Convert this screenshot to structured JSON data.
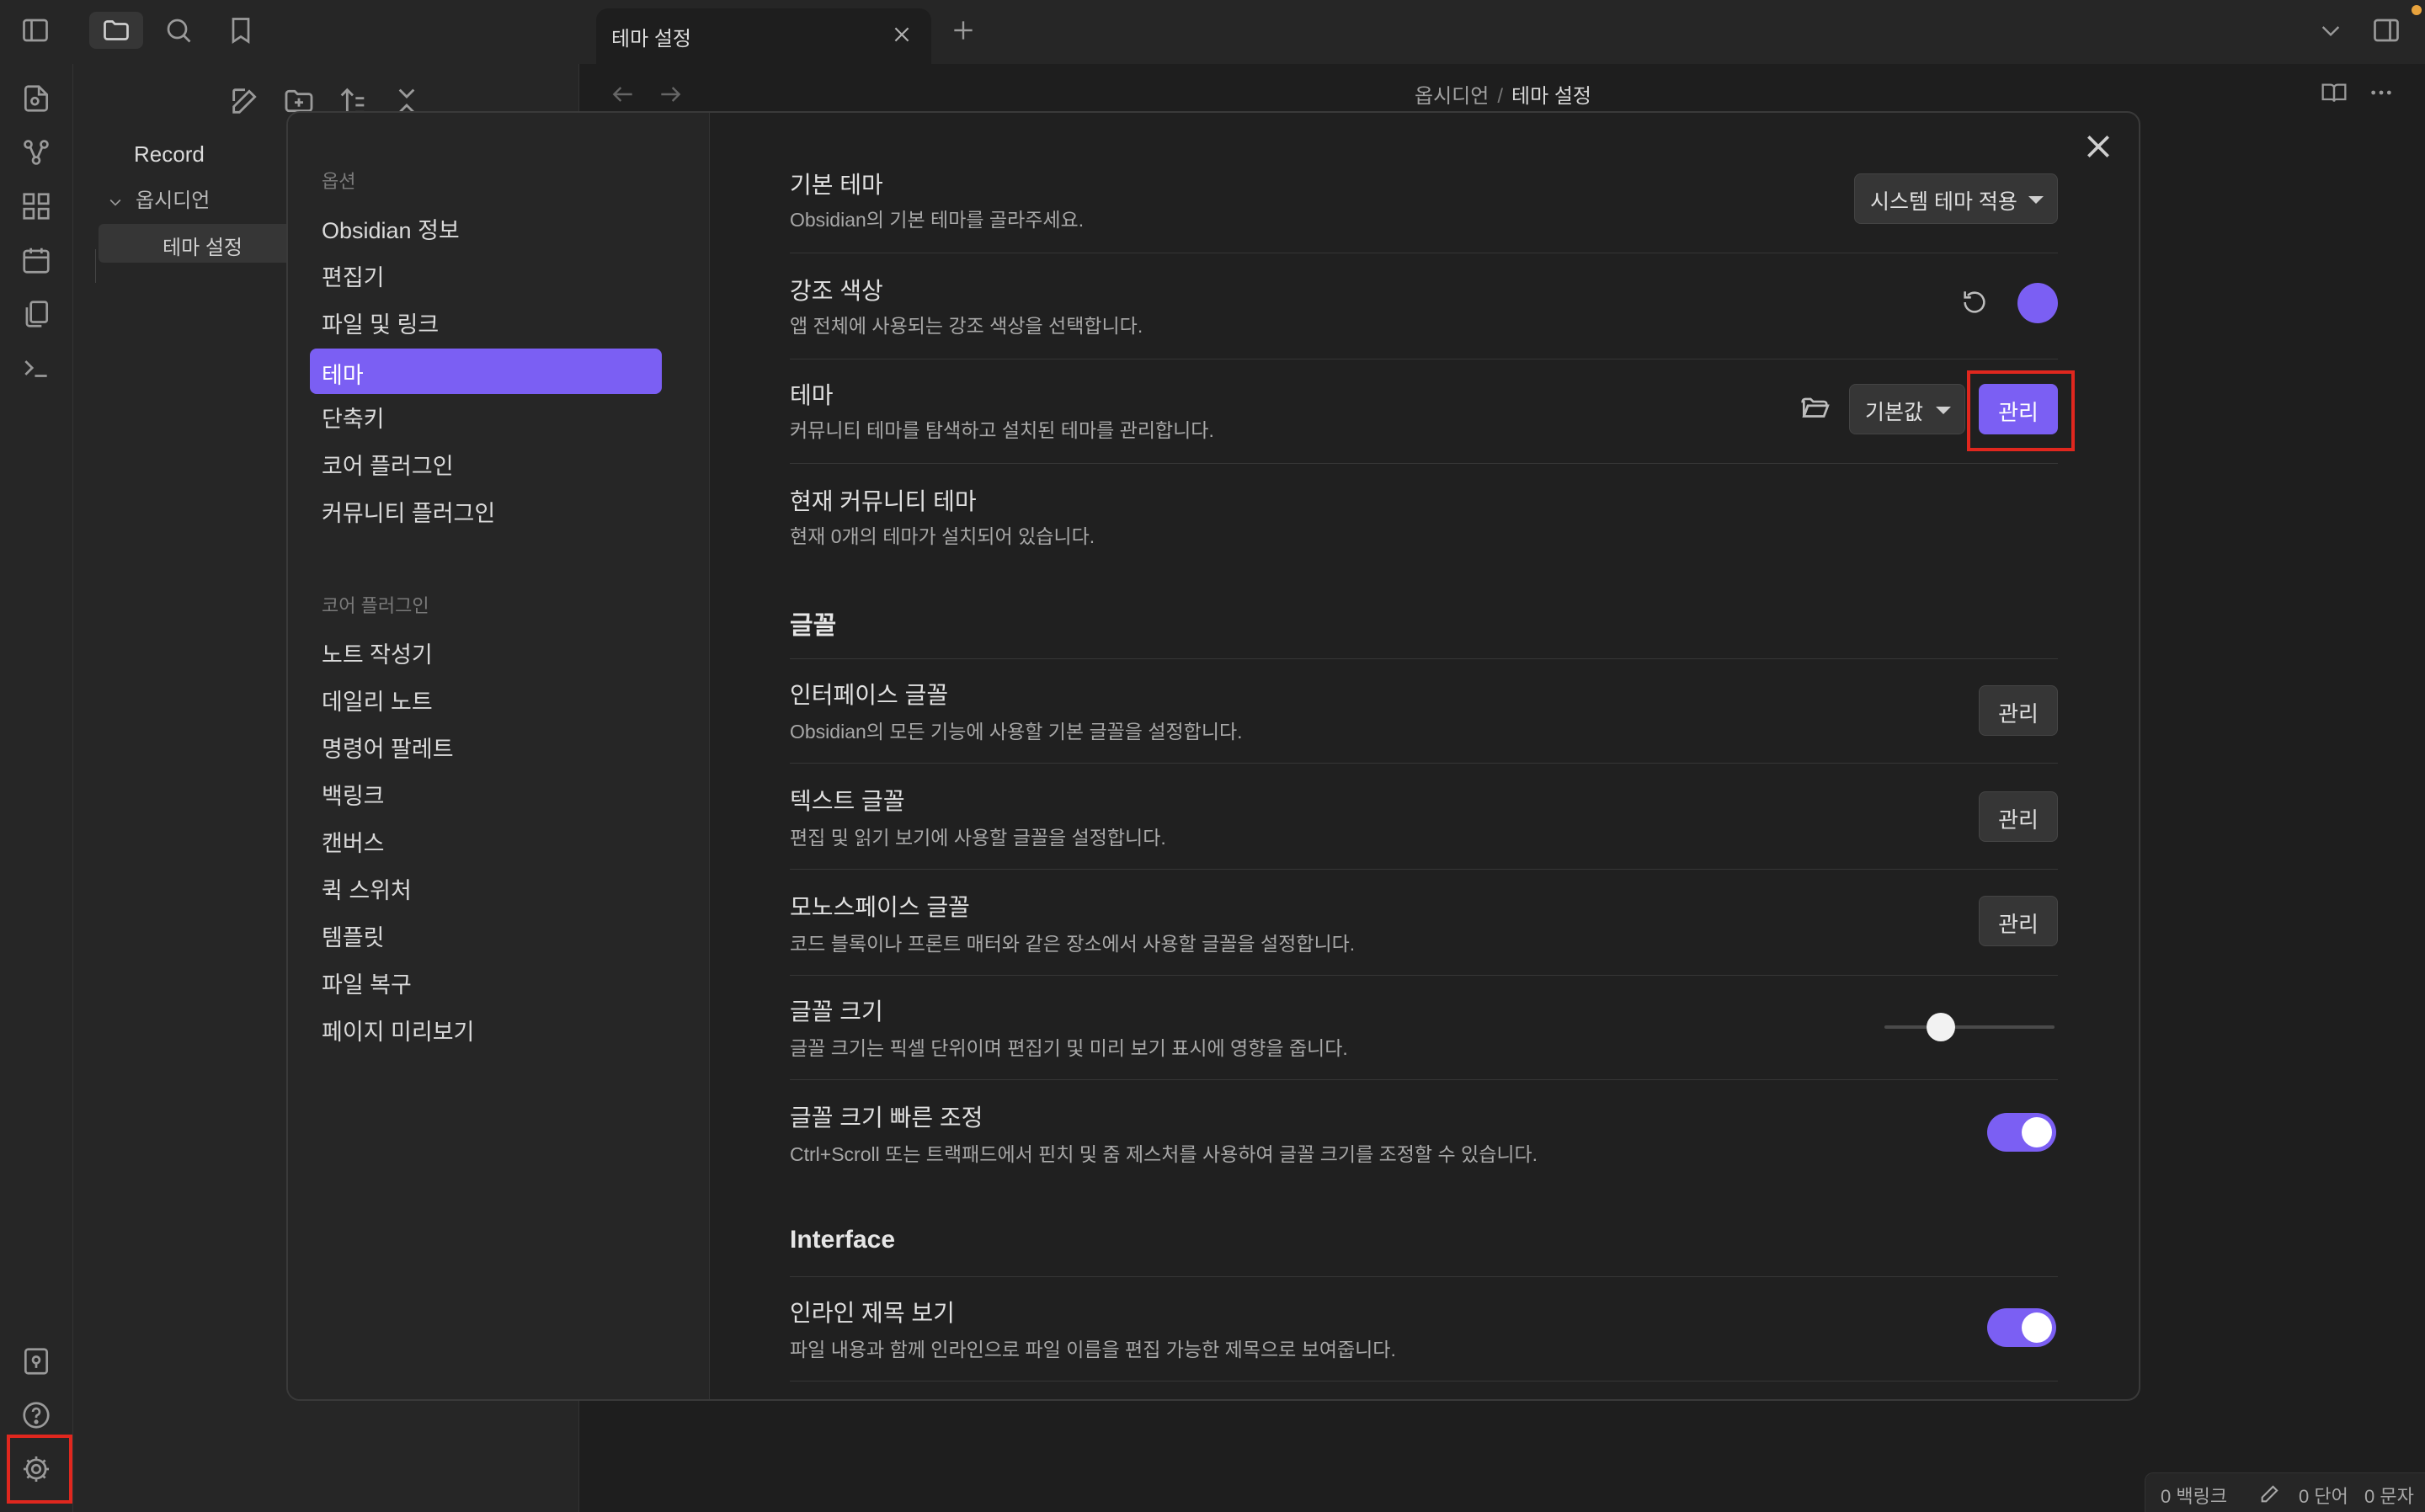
{
  "tab": {
    "title": "테마 설정"
  },
  "editor": {
    "breadcrumb": {
      "parent": "옵시디언",
      "sep": "/",
      "current": "테마 설정"
    }
  },
  "explorer": {
    "vault_name": "Record",
    "folder": "옵시디언",
    "file": "테마 설정"
  },
  "settings_nav": {
    "group1_header": "옵션",
    "group1_items": [
      "Obsidian 정보",
      "편집기",
      "파일 및 링크",
      "테마",
      "단축키",
      "코어 플러그인",
      "커뮤니티 플러그인"
    ],
    "active_item": "테마",
    "group2_header": "코어 플러그인",
    "group2_items": [
      "노트 작성기",
      "데일리 노트",
      "명령어 팔레트",
      "백링크",
      "캔버스",
      "퀵 스위처",
      "템플릿",
      "파일 복구",
      "페이지 미리보기"
    ]
  },
  "settings": {
    "base_theme": {
      "name": "기본 테마",
      "desc": "Obsidian의 기본 테마를 골라주세요.",
      "value": "시스템 테마 적용"
    },
    "accent_color": {
      "name": "강조 색상",
      "desc": "앱 전체에 사용되는 강조 색상을 선택합니다.",
      "color": "#7b5ff3"
    },
    "theme": {
      "name": "테마",
      "desc": "커뮤니티 테마를 탐색하고 설치된 테마를 관리합니다.",
      "value": "기본값",
      "button": "관리"
    },
    "community_themes": {
      "name": "현재 커뮤니티 테마",
      "desc": "현재 0개의 테마가 설치되어 있습니다."
    },
    "font_section": "글꼴",
    "interface_font": {
      "name": "인터페이스 글꼴",
      "desc": "Obsidian의 모든 기능에 사용할 기본 글꼴을 설정합니다.",
      "button": "관리"
    },
    "text_font": {
      "name": "텍스트 글꼴",
      "desc": "편집 및 읽기 보기에 사용할 글꼴을 설정합니다.",
      "button": "관리"
    },
    "mono_font": {
      "name": "모노스페이스 글꼴",
      "desc": "코드 블록이나 프론트 매터와 같은 장소에서 사용할 글꼴을 설정합니다.",
      "button": "관리"
    },
    "font_size": {
      "name": "글꼴 크기",
      "desc": "글꼴 크기는 픽셀 단위이며 편집기 및 미리 보기 표시에 영향을 줍니다.",
      "level": 0.33
    },
    "quick_font_size": {
      "name": "글꼴 크기 빠른 조정",
      "desc": "Ctrl+Scroll 또는 트랙패드에서 핀치 및 줌 제스처를 사용하여 글꼴 크기를 조정할 수 있습니다.",
      "enabled": true
    },
    "interface_section": "Interface",
    "inline_title": {
      "name": "인라인 제목 보기",
      "desc": "파일 내용과 함께 인라인으로 파일 이름을 편집 가능한 제목으로 보여줍니다.",
      "enabled": true
    }
  },
  "statusbar": {
    "backlinks": "0 백링크",
    "words": "0 단어",
    "chars": "0 문자"
  },
  "colors": {
    "accent": "#7b5ff3",
    "highlight": "#e0271e",
    "background": "#1e1e1e",
    "panel": "#262626"
  }
}
